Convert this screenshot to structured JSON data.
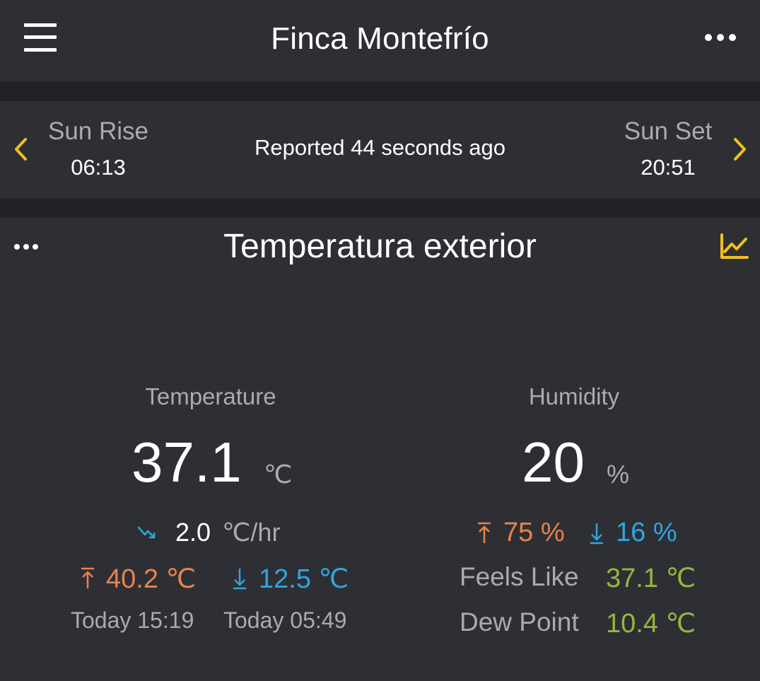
{
  "header": {
    "menu_icon": "hamburger-menu-icon",
    "title": "Finca Montefrío",
    "more_icon": "more-horizontal-icon"
  },
  "sun": {
    "prev_icon": "chevron-left-icon",
    "next_icon": "chevron-right-icon",
    "sunrise_label": "Sun Rise",
    "sunrise_time": "06:13",
    "reported": "Reported 44 seconds ago",
    "sunset_label": "Sun Set",
    "sunset_time": "20:51",
    "accent_color": "#f0c020"
  },
  "card": {
    "title": "Temperatura exterior",
    "more_icon": "more-horizontal-icon",
    "chart_icon": "line-chart-icon",
    "temperature": {
      "label": "Temperature",
      "value": "37.1",
      "unit": "℃",
      "trend_icon": "trend-down-icon",
      "trend_value": "2.0",
      "trend_unit": "℃/hr",
      "high": "40.2 ℃",
      "low": "12.5 ℃",
      "high_time": "Today 15:19",
      "low_time": "Today 05:49"
    },
    "humidity": {
      "label": "Humidity",
      "value": "20",
      "unit": "%",
      "high": "75 %",
      "low": "16 %",
      "feels_like_label": "Feels Like",
      "feels_like_value": "37.1 ℃",
      "dew_point_label": "Dew Point",
      "dew_point_value": "10.4 ℃"
    },
    "colors": {
      "high": "#e8844a",
      "low": "#2fa6e0",
      "derived": "#94b83c"
    }
  }
}
